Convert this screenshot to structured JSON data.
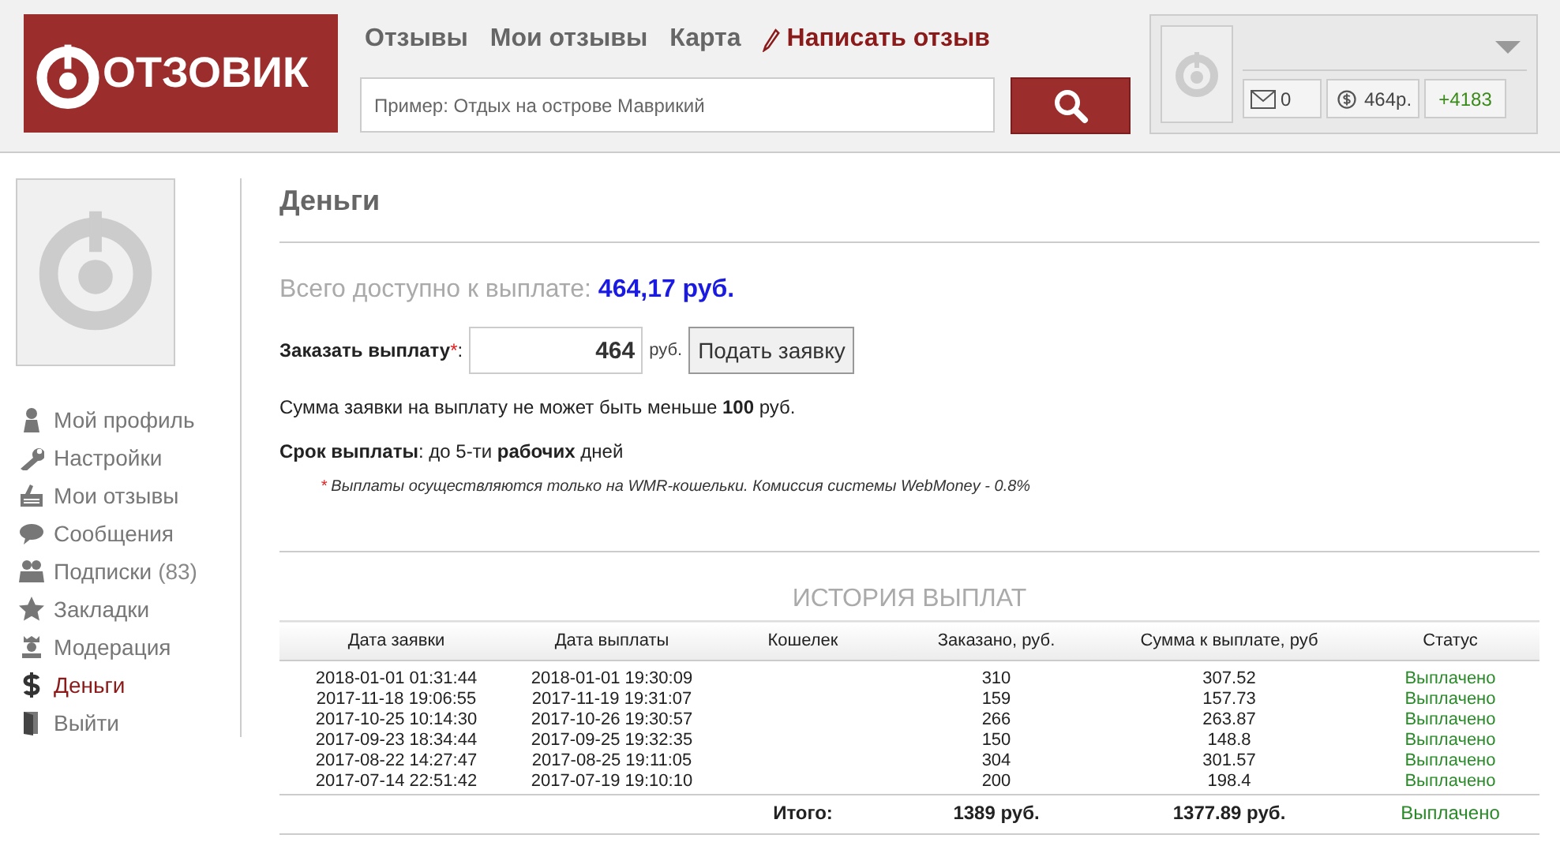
{
  "header": {
    "logo": "ОТЗОВИК",
    "nav": [
      {
        "label": "Отзывы",
        "kind": "link"
      },
      {
        "label": "Мои отзывы",
        "kind": "link"
      },
      {
        "label": "Карта",
        "kind": "link"
      },
      {
        "label": "Написать отзыв",
        "kind": "write"
      }
    ],
    "search": {
      "placeholder": "Пример: Отдых на острове Маврикий"
    },
    "user": {
      "messages": "0",
      "balance": "464р.",
      "rating": "+4183"
    }
  },
  "sidebar": {
    "items": [
      {
        "label": "Мой профиль",
        "selected": false
      },
      {
        "label": "Настройки",
        "selected": false
      },
      {
        "label": "Мои отзывы",
        "selected": false
      },
      {
        "label": "Сообщения",
        "selected": false
      },
      {
        "label": "Подписки",
        "count": "(83)",
        "selected": false
      },
      {
        "label": "Закладки",
        "selected": false
      },
      {
        "label": "Модерация",
        "selected": false
      },
      {
        "label": "Деньги",
        "selected": true
      },
      {
        "label": "Выйти",
        "selected": false
      }
    ]
  },
  "page": {
    "title": "Деньги",
    "available_label": "Всего доступно к выплате:",
    "available_value": "464,17 руб.",
    "order_label": "Заказать выплату",
    "order_required": "*",
    "order_colon": ":",
    "order_value": "464",
    "order_unit": "руб.",
    "submit": "Подать заявку",
    "min_note": "Сумма заявки на выплату не может быть меньше **100** руб.",
    "term_note": "**Срок выплаты**: до 5-ти **рабочих** дней",
    "footnote_mark": "*",
    "footnote": "Выплаты осуществляются только на WMR-кошельки. Комиссия системы WebMoney - 0.8%"
  },
  "history": {
    "title": "ИСТОРИЯ ВЫПЛАТ",
    "columns": [
      "Дата заявки",
      "Дата выплаты",
      "Кошелек",
      "Заказано, руб.",
      "Сумма к выплате, руб",
      "Статус"
    ],
    "rows": [
      {
        "requested": "2018-01-01 01:31:44",
        "paid": "2018-01-01 19:30:09",
        "ordered": "310",
        "amount": "307.52",
        "status": "Выплачено"
      },
      {
        "requested": "2017-11-18 19:06:55",
        "paid": "2017-11-19 19:31:07",
        "ordered": "159",
        "amount": "157.73",
        "status": "Выплачено"
      },
      {
        "requested": "2017-10-25 10:14:30",
        "paid": "2017-10-26 19:30:57",
        "ordered": "266",
        "amount": "263.87",
        "status": "Выплачено"
      },
      {
        "requested": "2017-09-23 18:34:44",
        "paid": "2017-09-25 19:32:35",
        "ordered": "150",
        "amount": "148.8",
        "status": "Выплачено"
      },
      {
        "requested": "2017-08-22 14:27:47",
        "paid": "2017-08-25 19:11:05",
        "ordered": "304",
        "amount": "301.57",
        "status": "Выплачено"
      },
      {
        "requested": "2017-07-14 22:51:42",
        "paid": "2017-07-19 19:10:10",
        "ordered": "200",
        "amount": "198.4",
        "status": "Выплачено"
      }
    ],
    "total": {
      "label": "Итого:",
      "ordered": "1389 руб.",
      "amount": "1377.89 руб.",
      "status": "Выплачено"
    }
  }
}
